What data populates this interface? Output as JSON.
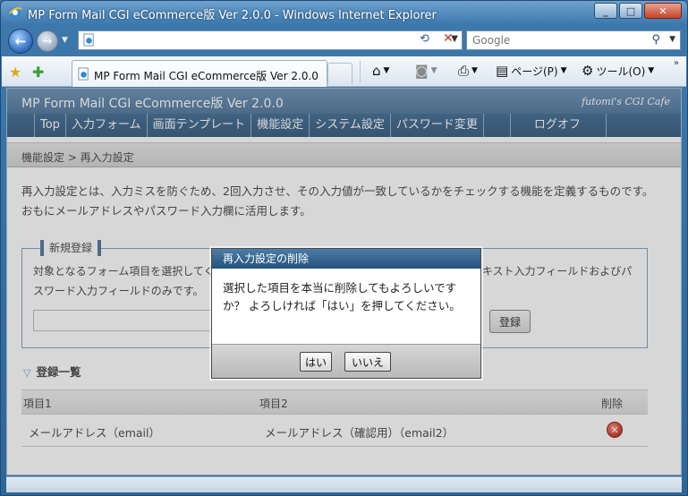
{
  "window": {
    "title": "MP Form Mail CGI eCommerce版 Ver 2.0.0 - Windows Internet Explorer",
    "minimize": "_",
    "maximize": "□",
    "close": "✕"
  },
  "address": {
    "url": "",
    "search_placeholder": "Google"
  },
  "tab": {
    "label": "MP Form Mail CGI eCommerce版 Ver 2.0.0"
  },
  "commands": {
    "page": "ページ(P)",
    "tools": "ツール(O)"
  },
  "app": {
    "title": "MP Form Mail CGI eCommerce版 Ver 2.0.0",
    "brand": "futomi's CGI Cafe",
    "nav": [
      "Top",
      "入力フォーム",
      "画面テンプレート",
      "機能設定",
      "システム設定",
      "パスワード変更",
      "ログオフ"
    ]
  },
  "breadcrumb": "機能設定 > 再入力設定",
  "description": "再入力設定とは、入力ミスを防ぐため、2回入力させ、その入力値が一致しているかをチェックする機能を定義するものです。おもにメールアドレスやパスワード入力欄に活用します。",
  "new_entry": {
    "legend": "新規登録",
    "text": "対象となるフォーム項目を選択してください。再入力設定の対象となる入力フォーム項目はテキスト入力フィールドおよびパスワード入力フィールドのみです。",
    "register_button": "登録"
  },
  "list": {
    "heading": "登録一覧",
    "columns": [
      "項目1",
      "項目2",
      "削除"
    ],
    "rows": [
      {
        "item1": "メールアドレス（email）",
        "item2": "メールアドレス（確認用）（email2）"
      }
    ]
  },
  "dialog": {
    "title": "再入力設定の削除",
    "message": "選択した項目を本当に削除してもよろしいですか？ よろしければ「はい」を押してください。",
    "yes": "はい",
    "no": "いいえ"
  },
  "colors": {
    "header": "#3e6b93",
    "nav": "#1f4a72",
    "delete": "#c41a10"
  }
}
